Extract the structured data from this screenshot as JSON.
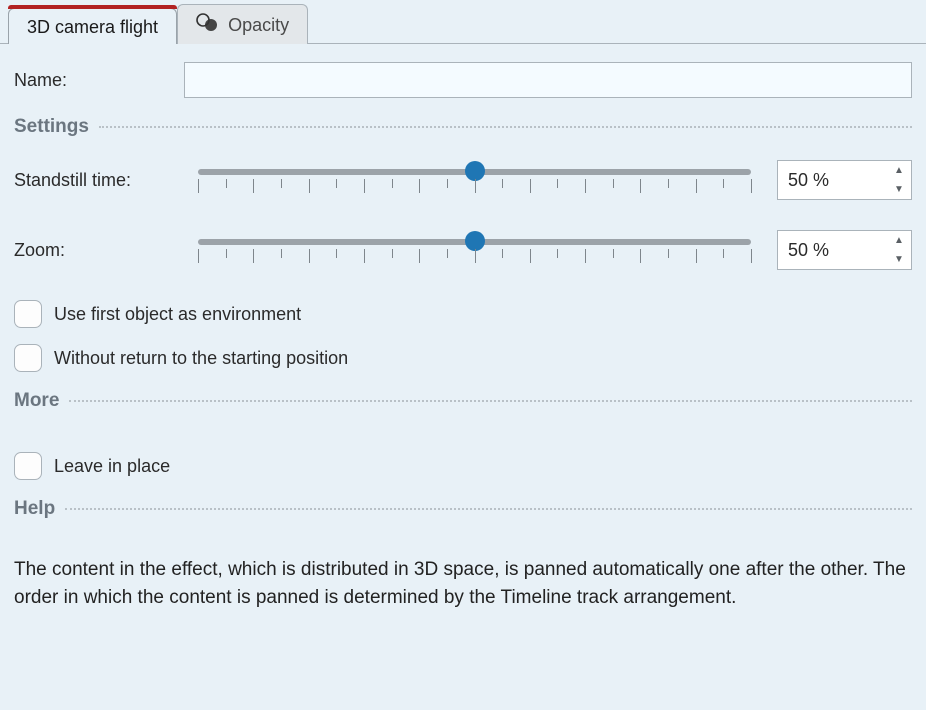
{
  "tabs": {
    "active": "3D camera flight",
    "inactive": "Opacity"
  },
  "name_field": {
    "label": "Name:",
    "value": ""
  },
  "sections": {
    "settings": "Settings",
    "more": "More",
    "help": "Help"
  },
  "sliders": {
    "standstill": {
      "label": "Standstill time:",
      "value": 50,
      "display": "50 %"
    },
    "zoom": {
      "label": "Zoom:",
      "value": 50,
      "display": "50 %"
    }
  },
  "checkboxes": {
    "first_object_env": {
      "label": "Use first object as environment",
      "checked": false
    },
    "no_return": {
      "label": "Without return to the starting position",
      "checked": false
    },
    "leave_in_place": {
      "label": "Leave in place",
      "checked": false
    }
  },
  "help_text": "The content in the effect, which is distributed in 3D space, is panned automatically one after the other. The order in which the content is panned is determined by the Timeline track arrangement."
}
